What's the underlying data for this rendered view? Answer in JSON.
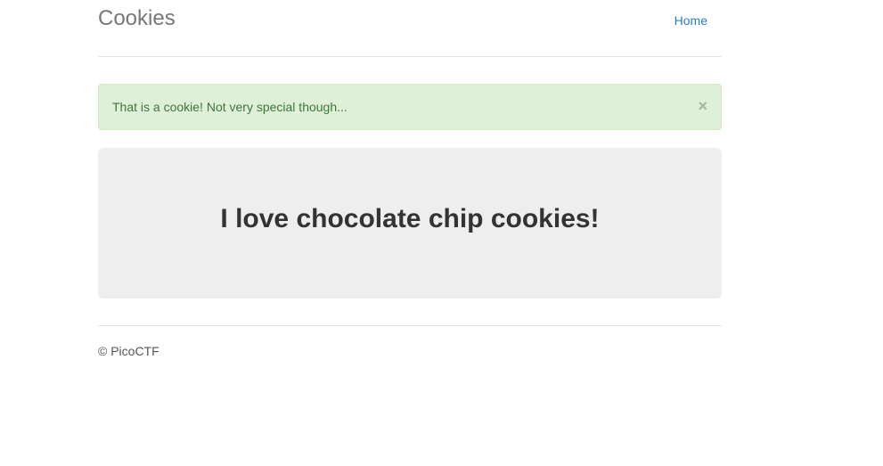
{
  "header": {
    "brand": "Cookies",
    "nav": {
      "home_label": "Home"
    }
  },
  "alert": {
    "message": "That is a cookie! Not very special though...",
    "close_label": "×"
  },
  "jumbotron": {
    "heading": "I love chocolate chip cookies!"
  },
  "footer": {
    "copyright": "© PicoCTF"
  },
  "colors": {
    "link": "#337ab7",
    "alert_success_bg": "#dff0d8",
    "alert_success_text": "#3c763d",
    "jumbotron_bg": "#eeeeee"
  }
}
